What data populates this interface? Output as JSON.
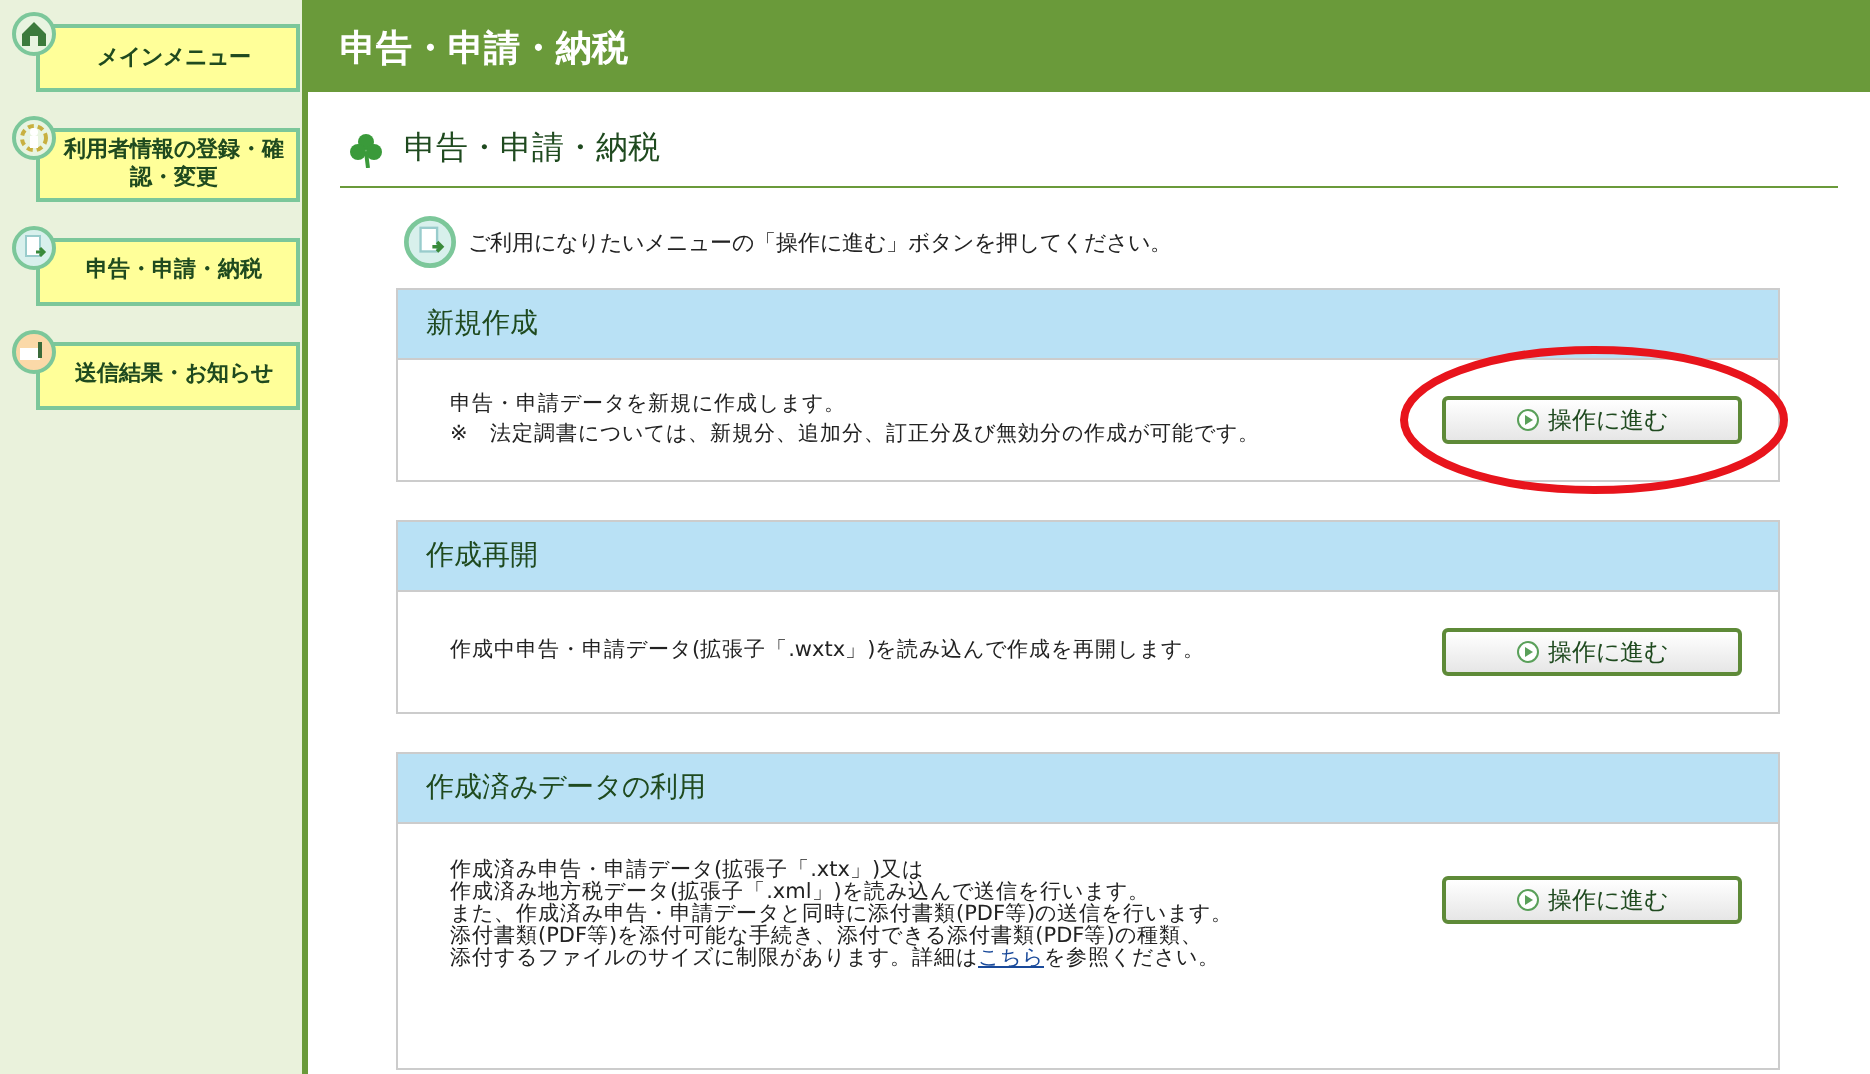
{
  "sidebar": {
    "items": [
      {
        "label": "メインメニュー"
      },
      {
        "label": "利用者情報の登録・確認・変更"
      },
      {
        "label": "申告・申請・納税"
      },
      {
        "label": "送信結果・お知らせ"
      }
    ]
  },
  "header": {
    "title": "申告・申請・納税"
  },
  "page_title": "申告・申請・納税",
  "instruction": "ご利用になりたいメニューの「操作に進む」ボタンを押してください。",
  "sections": [
    {
      "title": "新規作成",
      "lines": [
        "申告・申請データを新規に作成します。",
        "※　法定調書については、新規分、追加分、訂正分及び無効分の作成が可能です。"
      ],
      "button": "操作に進む",
      "highlighted": true
    },
    {
      "title": "作成再開",
      "lines": [
        "作成中申告・申請データ(拡張子「.wxtx」)を読み込んで作成を再開します。"
      ],
      "button": "操作に進む",
      "highlighted": false
    },
    {
      "title": "作成済みデータの利用",
      "lines": [
        "作成済み申告・申請データ(拡張子「.xtx」)又は",
        "作成済み地方税データ(拡張子「.xml」)を読み込んで送信を行います。",
        "また、作成済み申告・申請データと同時に添付書類(PDF等)の送信を行います。",
        "添付書類(PDF等)を添付可能な手続き、添付できる添付書類(PDF等)の種類、",
        "添付するファイルのサイズに制限があります。詳細は"
      ],
      "link": "こちら",
      "after_link": "を参照ください。",
      "button": "操作に進む",
      "highlighted": false
    }
  ]
}
